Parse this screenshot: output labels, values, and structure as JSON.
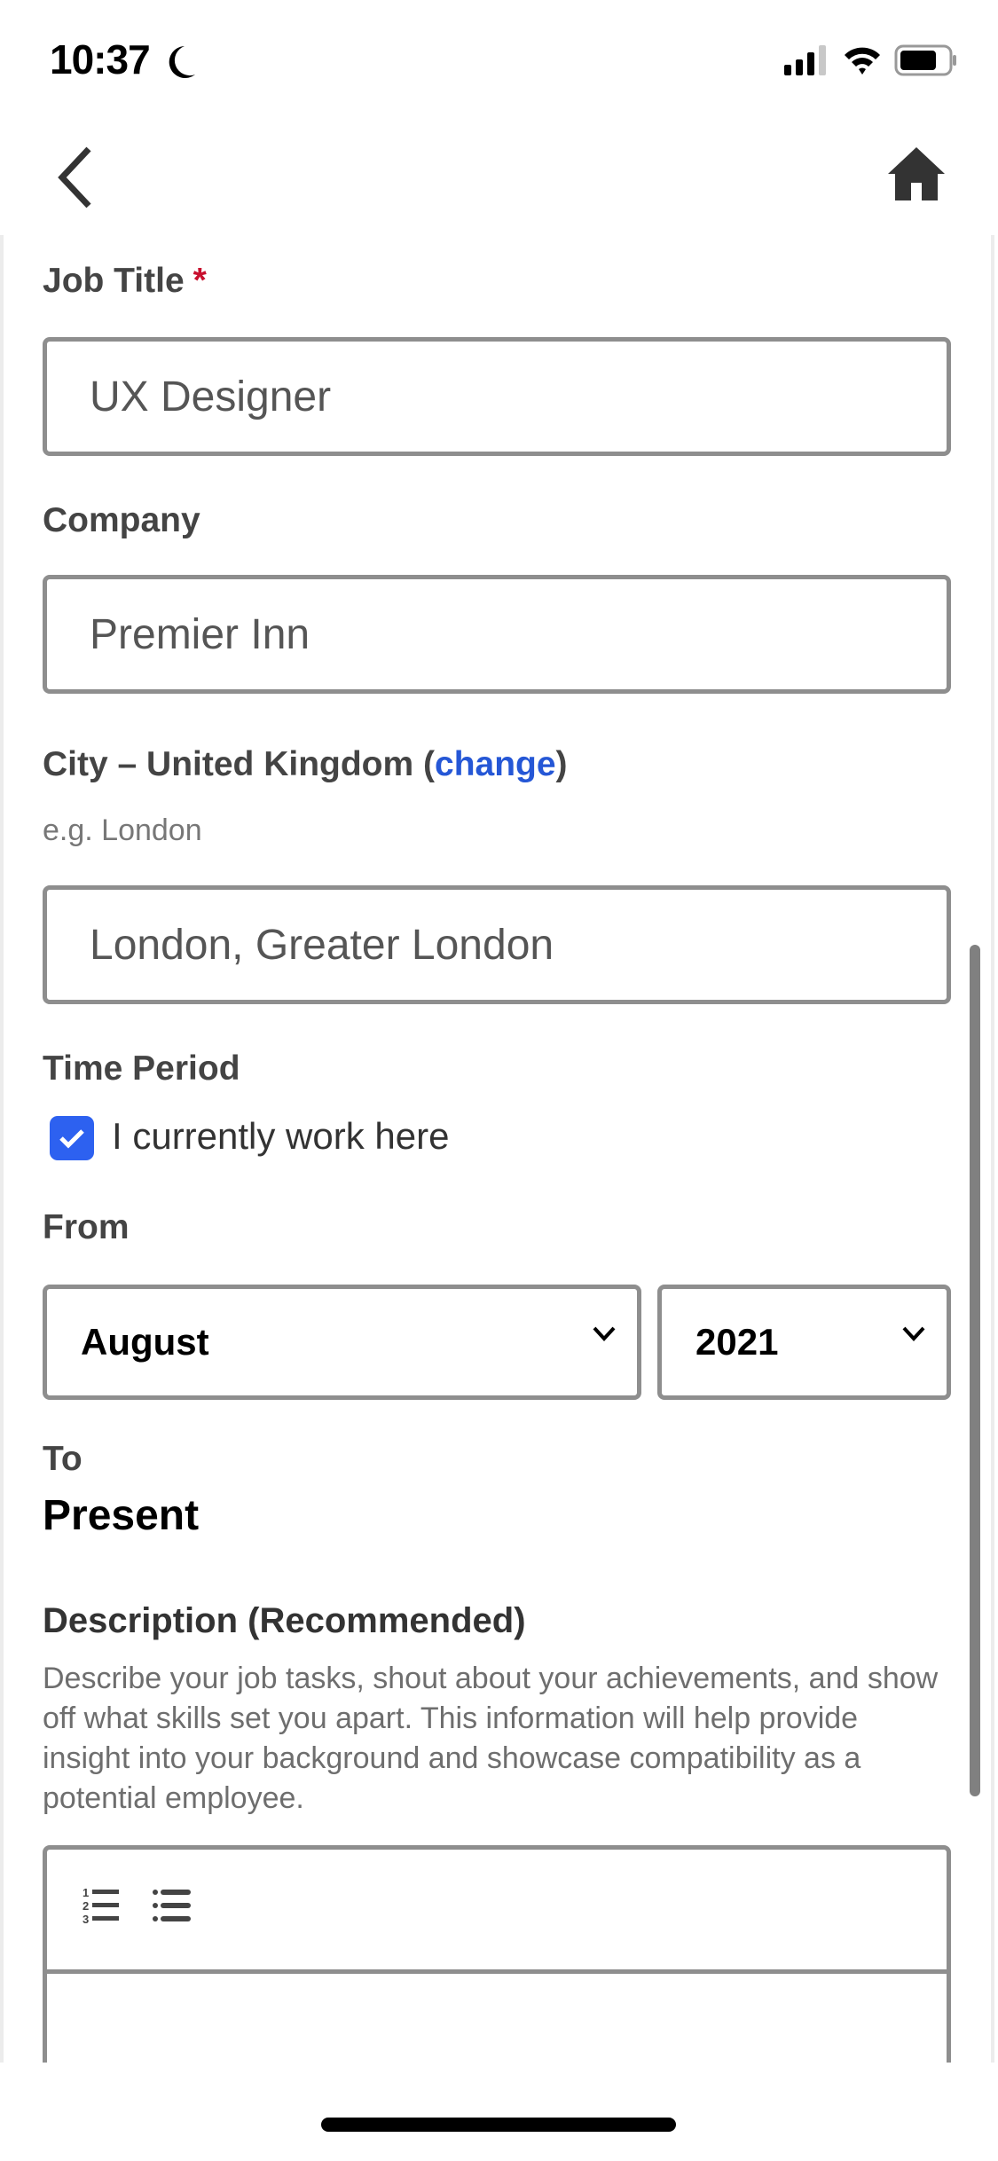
{
  "status_bar": {
    "time": "10:37",
    "focus_icon": "moon-icon",
    "icons": [
      "cellular-signal-icon",
      "wifi-icon",
      "battery-icon"
    ]
  },
  "nav": {
    "back_icon": "chevron-left-icon",
    "home_icon": "home-icon"
  },
  "form": {
    "job_title": {
      "label": "Job Title",
      "required_mark": "*",
      "value": "UX Designer"
    },
    "company": {
      "label": "Company",
      "value": "Premier Inn"
    },
    "city": {
      "label_prefix": "City – United Kingdom (",
      "change_link": "change",
      "label_suffix": ")",
      "hint": "e.g. London",
      "value": "London, Greater London"
    },
    "time_period": {
      "label": "Time Period",
      "current_checkbox_label": "I currently work here",
      "current_checked": true
    },
    "from": {
      "label": "From",
      "month": "August",
      "year": "2021"
    },
    "to": {
      "label": "To",
      "value": "Present"
    },
    "description": {
      "title": "Description (Recommended)",
      "help_text": "Describe your job tasks, shout about your achievements, and show off what skills set you apart. This information will help provide insight into your background and showcase compatibility as a potential employee.",
      "toolbar": [
        "ordered-list-icon",
        "bullet-list-icon"
      ],
      "value": ""
    }
  },
  "colors": {
    "accent": "#2d61f0",
    "link": "#2557d6",
    "required": "#c8102e",
    "border": "#8e8e8e"
  }
}
